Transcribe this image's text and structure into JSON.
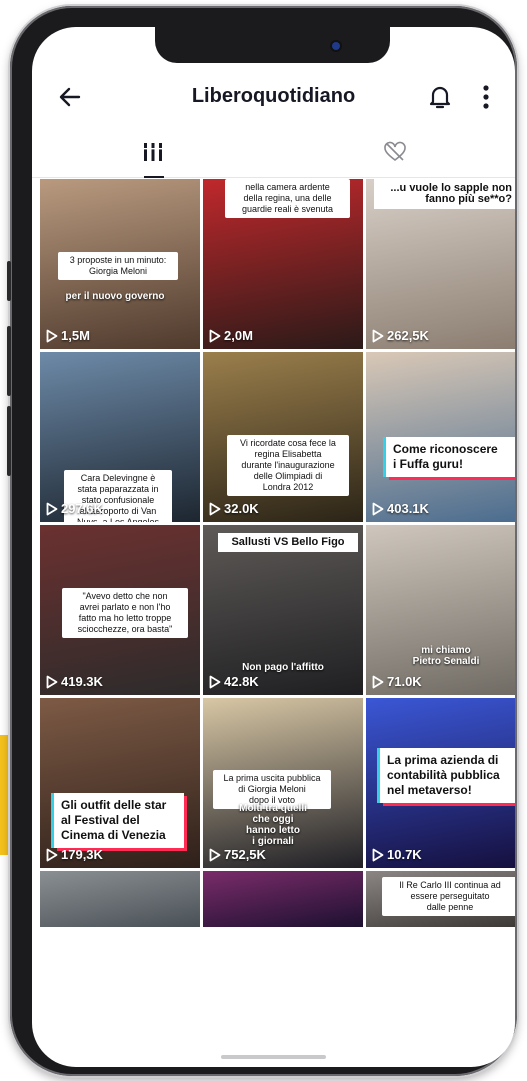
{
  "header": {
    "title": "Liberoquotidiano",
    "back_icon": "arrow-left-icon",
    "bell_icon": "bell-icon",
    "more_icon": "more-vertical-icon"
  },
  "tabs": [
    {
      "icon": "grid-icon",
      "selected": true
    },
    {
      "icon": "hidden-heart-icon",
      "selected": false
    }
  ],
  "colors": {
    "accent_yellow": "#f6c21c",
    "tiktok_cyan": "#35d0e6",
    "tiktok_red": "#fe2c55"
  },
  "videos": [
    {
      "caption": "3 proposte in un minuto:\nGiorgia Meloni",
      "overlay": "per il nuovo governo",
      "views": "1,5M",
      "bg": [
        "#b99a7f",
        "#4f3a2d"
      ]
    },
    {
      "caption": "nella camera ardente\ndella regina, una delle\nguardie reali è svenuta",
      "overlay": "",
      "views": "2,0M",
      "bg": [
        "#c0282c",
        "#2a1a18"
      ]
    },
    {
      "caption": "...u vuole lo sapple non\nfanno più se**o?",
      "overlay": "",
      "views": "262,5K",
      "bg": [
        "#d8d0c8",
        "#8b7d70"
      ]
    },
    {
      "caption": "Cara Delevingne è\nstata paparazzata in\nstato confusionale\nall'aeroporto di Van\nNuys, a Los Angeles",
      "overlay": "",
      "views": "297.6K",
      "bg": [
        "#6d8aa8",
        "#1d2630"
      ]
    },
    {
      "caption": "Vi ricordate cosa fece la\nregina Elisabetta\ndurante l'inaugurazione\ndelle Olimpiadi di\nLondra 2012",
      "overlay": "",
      "views": "32.0K",
      "bg": [
        "#9b7f4c",
        "#2b2417"
      ]
    },
    {
      "caption": "Come riconoscere\ni Fuffa guru!",
      "overlay": "",
      "views": "403.1K",
      "bg": [
        "#d9c8b6",
        "#4a6c8f"
      ]
    },
    {
      "caption": "\"Avevo detto che non\navrei parlato e non l'ho\nfatto ma ho letto troppe\nsciocchezze, ora basta\"",
      "overlay": "",
      "views": "419.3K",
      "bg": [
        "#6b3130",
        "#2d2b2b"
      ]
    },
    {
      "caption": "Sallusti VS Bello Figo",
      "overlay": "Non pago l'affitto",
      "views": "42.8K",
      "bg": [
        "#5e5a57",
        "#1f1f22"
      ]
    },
    {
      "caption": "",
      "overlay": "mi chiamo\nPietro Senaldi",
      "views": "71.0K",
      "bg": [
        "#cfc7bd",
        "#6f6a63"
      ]
    },
    {
      "caption": "Gli outfit delle star\nal Festival del\nCinema di Venezia",
      "overlay": "",
      "views": "179,3K",
      "bg": [
        "#7d5a45",
        "#2e201a"
      ]
    },
    {
      "caption": "La prima uscita pubblica\ndi Giorgia Meloni\ndopo il voto",
      "overlay": "Molti tra quelli\nche oggi\nhanno letto\ni giornali",
      "views": "752,5K",
      "bg": [
        "#d8c7a5",
        "#1f1f25"
      ]
    },
    {
      "caption": "La prima azienda di\ncontabilità pubblica\nnel metaverso!",
      "overlay": "",
      "views": "10.7K",
      "bg": [
        "#3b57d6",
        "#150f3d"
      ]
    },
    {
      "caption": "",
      "overlay": "",
      "views": "",
      "bg": [
        "#8a8f93",
        "#4a5156"
      ]
    },
    {
      "caption": "",
      "overlay": "",
      "views": "",
      "bg": [
        "#7a2c6a",
        "#1d1030"
      ]
    },
    {
      "caption": "Il Re Carlo III continua ad\nessere perseguitato\ndalle penne",
      "overlay": "",
      "views": "",
      "bg": [
        "#8b8683",
        "#3b3735"
      ]
    }
  ]
}
